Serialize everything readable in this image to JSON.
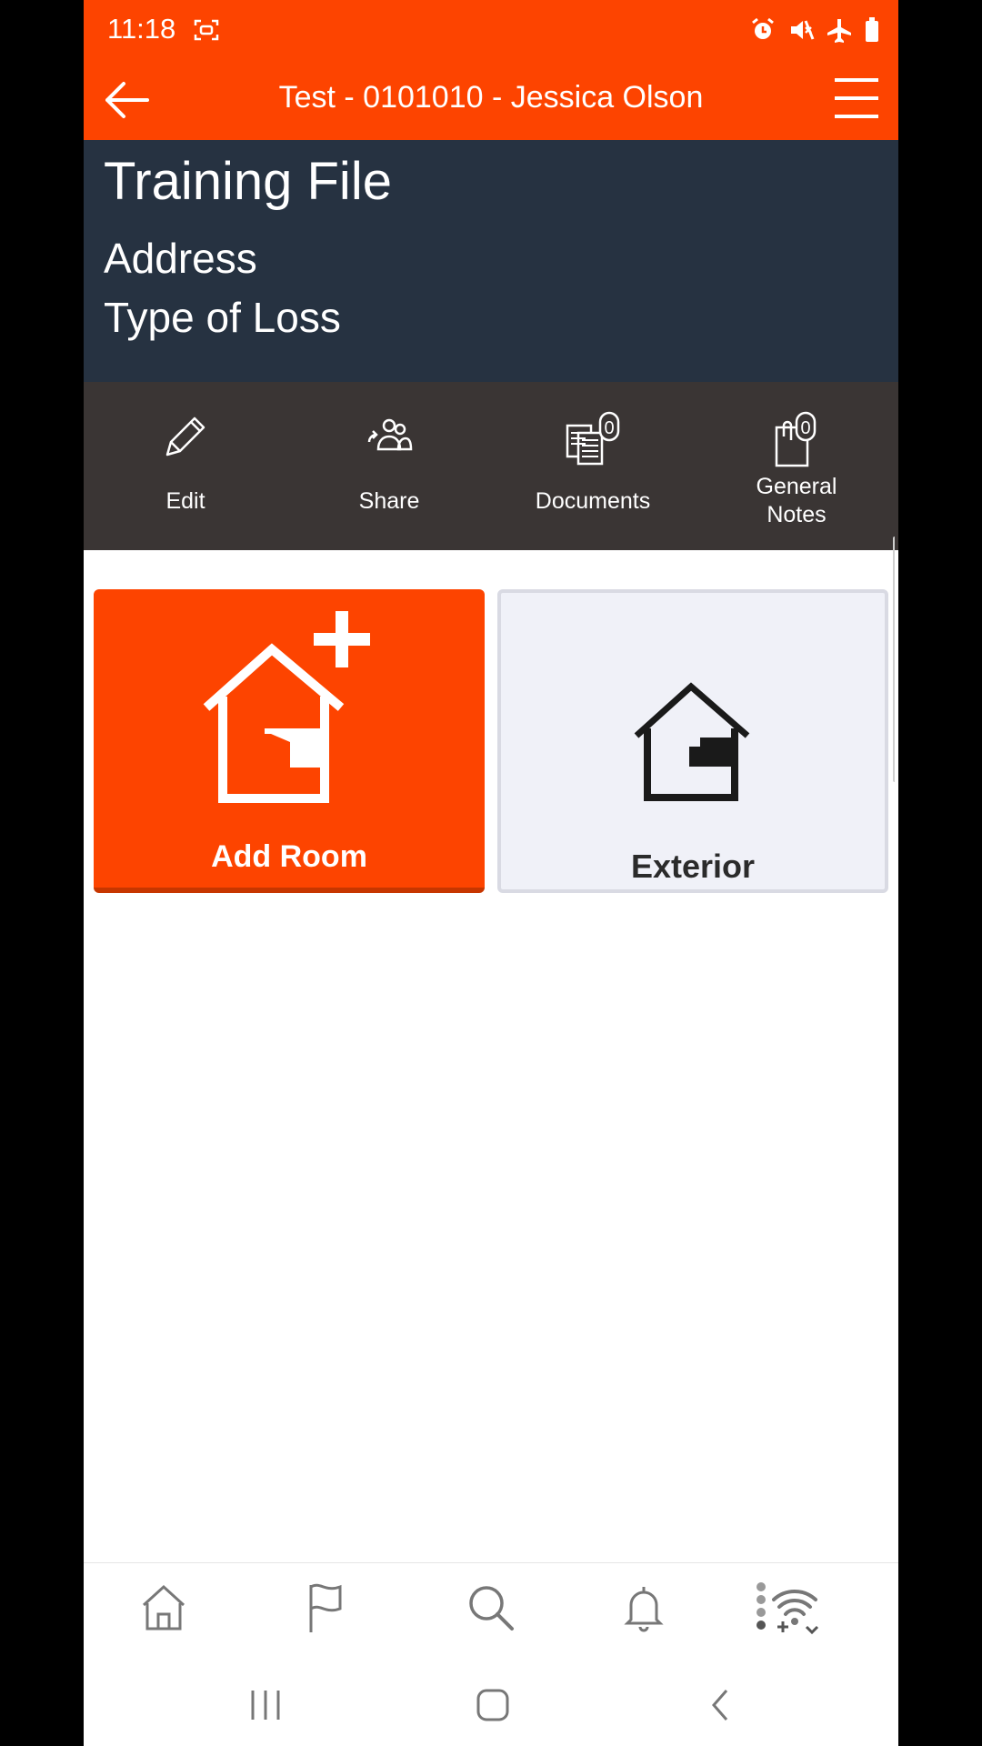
{
  "status_bar": {
    "time": "11:18",
    "left_icon": "screen-record-icon",
    "right_icons": [
      "alarm-icon",
      "mute-icon",
      "airplane-mode-icon",
      "battery-icon"
    ]
  },
  "header": {
    "title": "Test - 0101010 - Jessica Olson",
    "back_icon": "arrow-left-icon",
    "menu_icon": "hamburger-menu-icon"
  },
  "file_info": {
    "title": "Training File",
    "address": "Address",
    "type_of_loss": "Type of Loss"
  },
  "actions": [
    {
      "label": "Edit",
      "icon": "pencil-icon"
    },
    {
      "label": "Share",
      "icon": "share-people-icon"
    },
    {
      "label": "Documents",
      "icon": "documents-icon",
      "badge": "0"
    },
    {
      "label_line1": "General",
      "label_line2": "Notes",
      "icon": "notes-icon",
      "badge": "0"
    }
  ],
  "tiles": {
    "add_room": "Add Room",
    "exterior": "Exterior"
  },
  "tab_bar": [
    "home-icon",
    "flag-icon",
    "search-icon",
    "bell-icon",
    "wifi-sync-icon"
  ],
  "system_nav": [
    "recents-icon",
    "home-circle-icon",
    "back-chevron-icon"
  ],
  "colors": {
    "accent": "#fd4400",
    "info_panel": "#263241",
    "action_bar": "#3a3534",
    "tile_exterior": "#f0f1f8"
  }
}
